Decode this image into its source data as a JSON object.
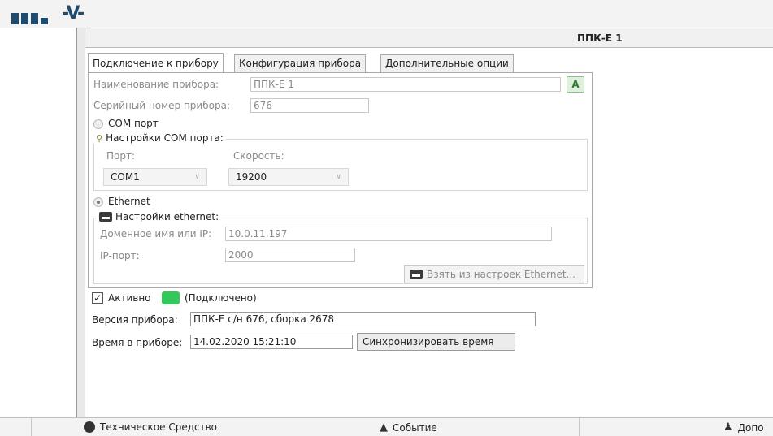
{
  "device_title": "ППК-Е 1",
  "tabs": [
    {
      "label": "Подключение к прибору"
    },
    {
      "label": "Конфигурация прибора"
    },
    {
      "label": "Дополнительные опции"
    }
  ],
  "device_name": {
    "label": "Наименование прибора:",
    "value": "ППК-Е 1"
  },
  "serial": {
    "label": "Серийный номер прибора:",
    "value": "676"
  },
  "com": {
    "radio_label": "COM порт",
    "group_title": "Настройки COM порта:",
    "port_label": "Порт:",
    "port_value": "COM1",
    "speed_label": "Скорость:",
    "speed_value": "19200"
  },
  "ethernet": {
    "radio_label": "Ethernet",
    "group_title": "Настройки ethernet:",
    "host_label": "Доменное имя или IP:",
    "host_value": "10.0.11.197",
    "port_label": "IP-порт:",
    "port_value": "2000",
    "take_button": "Взять из настроек Ethernet..."
  },
  "active": {
    "label": "Активно",
    "status_text": "(Подключено)",
    "status_color": "#34c759"
  },
  "version": {
    "label": "Версия прибора:",
    "value": "ППК-Е с/н 676, сборка 2678"
  },
  "time": {
    "label": "Время в приборе:",
    "value": "14.02.2020 15:21:10",
    "sync_button": "Синхронизировать время"
  },
  "bottom_bar": {
    "item1": "Техническое Средство",
    "item2": "Событие",
    "item3": "Допо"
  }
}
